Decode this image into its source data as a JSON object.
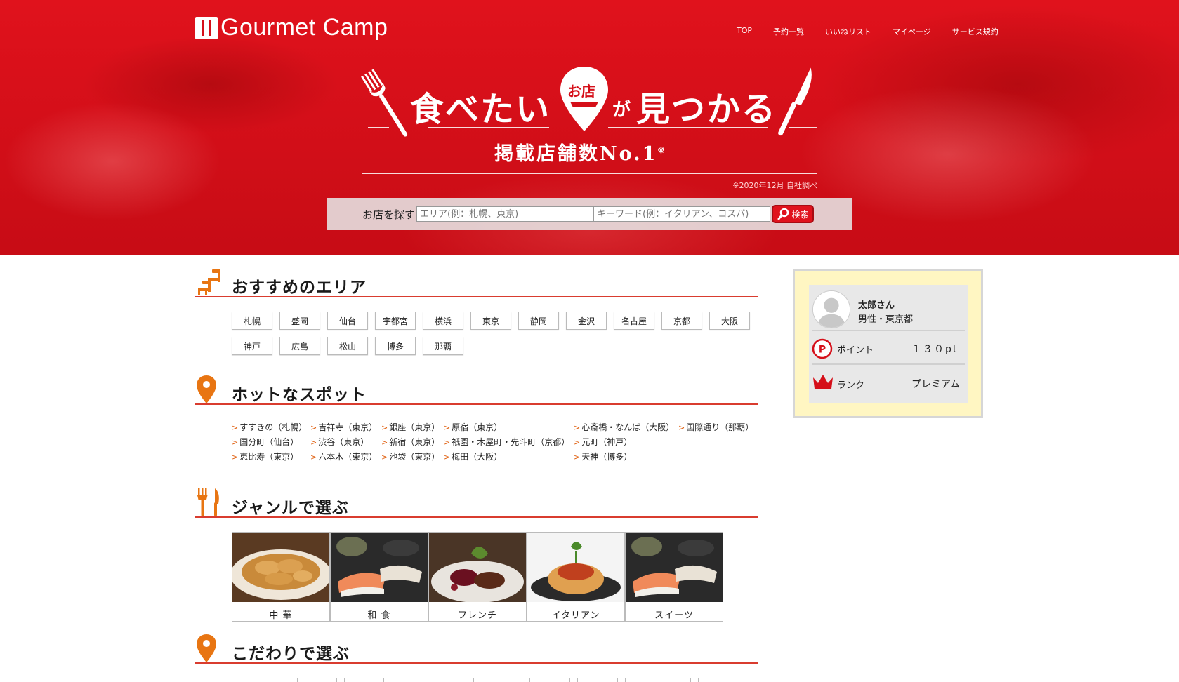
{
  "brand": {
    "name": "Gourmet Camp"
  },
  "nav": [
    "TOP",
    "予約一覧",
    "いいねリスト",
    "マイページ",
    "サービス規約"
  ],
  "hero": {
    "headline_part1": "食べたい",
    "pin_label": "お店",
    "headline_ga": "が",
    "headline_part2": "見つかる",
    "subheadline": "掲載店舗数No.1",
    "sub_mark": "※",
    "note": "※2020年12月 自社調べ"
  },
  "search": {
    "label": "お店を探す",
    "area_placeholder": "エリア(例：札幌、東京)",
    "keyword_placeholder": "キーワード(例：イタリアン、コスパ)",
    "button_label": "検索"
  },
  "sections": {
    "areas": {
      "title": "おすすめのエリア",
      "items": [
        "札幌",
        "盛岡",
        "仙台",
        "宇都宮",
        "横浜",
        "東京",
        "静岡",
        "金沢",
        "名古屋",
        "京都",
        "大阪",
        "神戸",
        "広島",
        "松山",
        "博多",
        "那覇"
      ]
    },
    "spots": {
      "title": "ホットなスポット",
      "columns": [
        [
          "すすきの（札幌）",
          "国分町（仙台）",
          "恵比寿（東京）"
        ],
        [
          "吉祥寺（東京）",
          "渋谷（東京）",
          "六本木（東京）"
        ],
        [
          "銀座（東京）",
          "新宿（東京）",
          "池袋（東京）"
        ],
        [
          "原宿（東京）",
          "祇園・木屋町・先斗町（京都）",
          "梅田（大阪）"
        ],
        [
          "心斎橋・なんば（大阪）",
          "元町（神戸）",
          "天神（博多）"
        ],
        [
          "国際通り（那覇）"
        ]
      ]
    },
    "genres": {
      "title": "ジャンルで選ぶ",
      "items": [
        "中 華",
        "和 食",
        "フレンチ",
        "イタリアン",
        "スイーツ"
      ]
    },
    "kodawari": {
      "title": "こだわりで選ぶ"
    }
  },
  "user": {
    "name": "太郎さん",
    "info": "男性・東京都",
    "points_label": "ポイント",
    "points_value": "１３０pt",
    "rank_label": "ランク",
    "rank_value": "プレミアム"
  },
  "colors": {
    "brand_red": "#d50f19",
    "accent_orange": "#e06010",
    "sidebar_bg": "#fff6c2"
  }
}
